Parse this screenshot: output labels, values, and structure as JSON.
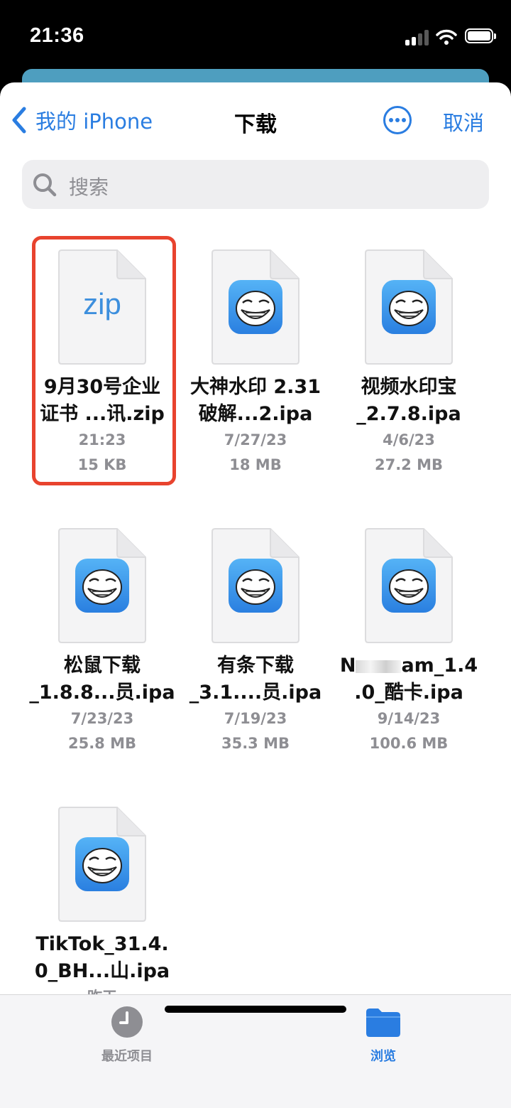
{
  "status": {
    "time": "21:36"
  },
  "nav": {
    "back_label": "我的 iPhone",
    "title": "下载",
    "cancel_label": "取消"
  },
  "search": {
    "placeholder": "搜索"
  },
  "files": [
    {
      "icon": "zip",
      "badge": "zip",
      "name_line1": "9月30号企业",
      "name_line2": "证书 ...讯.zip",
      "date": "21:23",
      "size": "15 KB",
      "highlighted": true
    },
    {
      "icon": "trollface-app-icon",
      "name_line1": "大神水印 2.31",
      "name_line2": "破解...2.ipa",
      "date": "7/27/23",
      "size": "18 MB"
    },
    {
      "icon": "trollface-app-icon",
      "name_line1": "视频水印宝",
      "name_line2": "_2.7.8.ipa",
      "date": "4/6/23",
      "size": "27.2 MB"
    },
    {
      "icon": "trollface-app-icon",
      "name_line1": "松鼠下载",
      "name_line2": "_1.8.8...员.ipa",
      "date": "7/23/23",
      "size": "25.8 MB"
    },
    {
      "icon": "trollface-app-icon",
      "name_line1": "有条下载",
      "name_line2": "_3.1....员.ipa",
      "date": "7/19/23",
      "size": "35.3 MB"
    },
    {
      "icon": "trollface-app-icon",
      "name_line1_start": "N",
      "name_line1_end": "am_1.4",
      "name_line2": ".0_酷卡.ipa",
      "date": "9/14/23",
      "size": "100.6 MB",
      "name_partially_redacted": true
    },
    {
      "icon": "trollface-app-icon",
      "name_line1": "TikTok_31.4.",
      "name_line2": "0_BH...山.ipa",
      "date": "昨天",
      "size": ""
    }
  ],
  "tabbar": {
    "recents_label": "最近项目",
    "browse_label": "浏览",
    "active_tab": "browse",
    "active_color": "#2a7de1",
    "inactive_color": "#8e8e93"
  },
  "colors": {
    "accent": "#2a7de1",
    "highlight_border": "#e8432e"
  }
}
